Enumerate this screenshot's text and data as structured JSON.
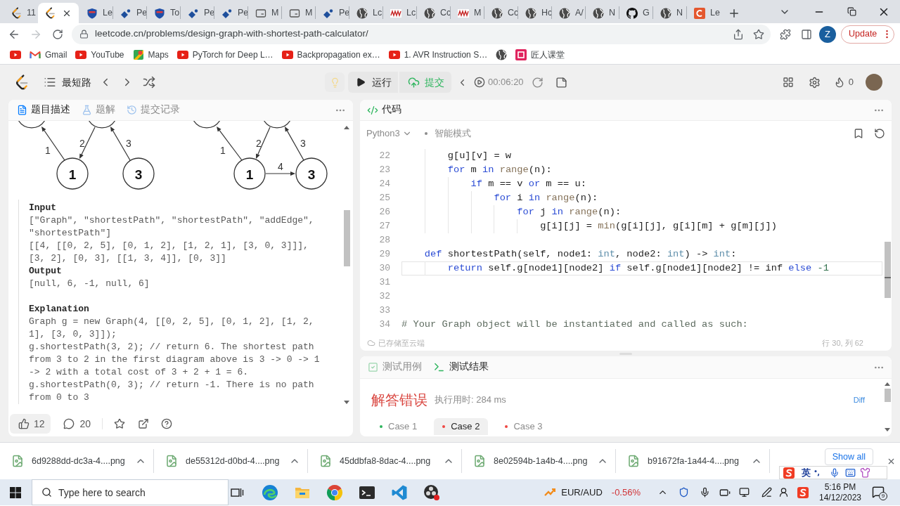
{
  "browser": {
    "tabs": [
      {
        "label": "11",
        "kind": "leetcode",
        "selected": false
      },
      {
        "kind": "leetcode",
        "selected": true
      },
      {
        "label": "Le",
        "kind": "shield",
        "selected": false
      },
      {
        "label": "Pe",
        "kind": "diamond",
        "selected": false
      },
      {
        "label": "To",
        "kind": "shield",
        "selected": false
      },
      {
        "label": "Pe",
        "kind": "diamond",
        "selected": false
      },
      {
        "label": "Pe",
        "kind": "diamond",
        "selected": false
      },
      {
        "label": "M",
        "kind": "card",
        "selected": false
      },
      {
        "label": "M",
        "kind": "card",
        "selected": false
      },
      {
        "label": "Pe",
        "kind": "diamond",
        "selected": false
      },
      {
        "label": "Lc",
        "kind": "globe",
        "selected": false
      },
      {
        "label": "Lc",
        "kind": "wave",
        "selected": false
      },
      {
        "label": "Cc",
        "kind": "globe",
        "selected": false
      },
      {
        "label": "M",
        "kind": "wave",
        "selected": false
      },
      {
        "label": "Cc",
        "kind": "globe",
        "selected": false
      },
      {
        "label": "Hc",
        "kind": "globe",
        "selected": false
      },
      {
        "label": "A/",
        "kind": "globe",
        "selected": false
      },
      {
        "label": "N",
        "kind": "globe",
        "selected": false
      },
      {
        "label": "G",
        "kind": "github",
        "selected": false
      },
      {
        "label": "N",
        "kind": "globe",
        "selected": false
      },
      {
        "label": "Le",
        "kind": "tile",
        "selected": false
      }
    ],
    "address": "leetcode.cn/problems/design-graph-with-shortest-path-calculator/",
    "profile": "Z",
    "update": "Update",
    "bookmarks": [
      {
        "kind": "youtube"
      },
      {
        "kind": "gmail",
        "label": "Gmail"
      },
      {
        "kind": "youtube",
        "label": "YouTube"
      },
      {
        "kind": "maps",
        "label": "Maps"
      },
      {
        "kind": "youtube",
        "label": "PyTorch for Deep L…"
      },
      {
        "kind": "youtube",
        "label": "Backpropagation ex…"
      },
      {
        "kind": "youtube",
        "label": "1. AVR Instruction S…"
      },
      {
        "kind": "globe"
      },
      {
        "kind": "badge",
        "label": "匠人课堂"
      }
    ]
  },
  "toolbar": {
    "problem_list": "最短路",
    "run": "运行",
    "submit": "提交",
    "timer": "00:06:20",
    "streak": "0"
  },
  "description": {
    "tabs": [
      {
        "label": "题目描述",
        "kind": "description",
        "selected": true
      },
      {
        "label": "题解",
        "kind": "solutions",
        "selected": false
      },
      {
        "label": "提交记录",
        "kind": "submissions",
        "selected": false
      }
    ],
    "diagrams": [
      {
        "kind": "before",
        "nodes": [
          "1",
          "3"
        ],
        "edge_labels": [
          "1",
          "2",
          "3"
        ]
      },
      {
        "kind": "after",
        "nodes": [
          "1",
          "3"
        ],
        "edge_labels": [
          "1",
          "2",
          "3",
          "4"
        ]
      }
    ],
    "example": {
      "io": [
        {
          "heading": "Input",
          "lines": [
            "[\"Graph\", \"shortestPath\", \"shortestPath\", \"addEdge\", \"shortestPath\"]",
            "[[4, [[0, 2, 5], [0, 1, 2], [1, 2, 1], [3, 0, 3]]], [3, 2], [0, 3], [[1, 3, 4]], [0, 3]]"
          ]
        },
        {
          "heading": "Output",
          "lines": [
            "[null, 6, -1, null, 6]"
          ]
        }
      ],
      "explanation": {
        "heading": "Explanation",
        "lines": [
          "Graph g = new Graph(4, [[0, 2, 5], [0, 1, 2], [1, 2, 1], [3, 0, 3]]);",
          "g.shortestPath(3, 2); // return 6. The shortest path from 3 to 2 in the first diagram above is 3 -> 0 -> 1 -> 2 with a total cost of 3 + 2 + 1 = 6.",
          "g.shortestPath(0, 3); // return -1. There is no path from 0 to 3"
        ]
      }
    },
    "likes": "12",
    "comments": "20"
  },
  "editor": {
    "title": "代码",
    "language": "Python3",
    "mode": "智能模式",
    "lines": [
      {
        "number": "22",
        "selected": false,
        "tokens": [
          {
            "kind": "plain",
            "text": "        g[u][v] = w"
          }
        ]
      },
      {
        "number": "23",
        "selected": false,
        "tokens": [
          {
            "kind": "keyword",
            "text": "        for"
          },
          {
            "kind": "plain",
            "text": " m "
          },
          {
            "kind": "keyword",
            "text": "in"
          },
          {
            "kind": "builtin",
            "text": " range"
          },
          {
            "kind": "plain",
            "text": "(n):"
          }
        ]
      },
      {
        "number": "24",
        "selected": false,
        "tokens": [
          {
            "kind": "keyword",
            "text": "            if"
          },
          {
            "kind": "plain",
            "text": " m == v "
          },
          {
            "kind": "keyword",
            "text": "or"
          },
          {
            "kind": "plain",
            "text": " m == u:"
          }
        ]
      },
      {
        "number": "25",
        "selected": false,
        "tokens": [
          {
            "kind": "keyword",
            "text": "                for"
          },
          {
            "kind": "plain",
            "text": " i "
          },
          {
            "kind": "keyword",
            "text": "in"
          },
          {
            "kind": "builtin",
            "text": " range"
          },
          {
            "kind": "plain",
            "text": "(n):"
          }
        ]
      },
      {
        "number": "26",
        "selected": false,
        "tokens": [
          {
            "kind": "keyword",
            "text": "                    for"
          },
          {
            "kind": "plain",
            "text": " j "
          },
          {
            "kind": "keyword",
            "text": "in"
          },
          {
            "kind": "builtin",
            "text": " range"
          },
          {
            "kind": "plain",
            "text": "(n):"
          }
        ]
      },
      {
        "number": "27",
        "selected": false,
        "tokens": [
          {
            "kind": "plain",
            "text": "                        g[i][j] = "
          },
          {
            "kind": "builtin",
            "text": "min"
          },
          {
            "kind": "plain",
            "text": "(g[i][j], g[i][m] + g[m][j])"
          }
        ]
      },
      {
        "number": "28",
        "selected": false
      },
      {
        "number": "29",
        "selected": false,
        "tokens": [
          {
            "kind": "keyword",
            "text": "    def"
          },
          {
            "kind": "plain",
            "text": " shortestPath(self, node1: "
          },
          {
            "kind": "type",
            "text": "int"
          },
          {
            "kind": "plain",
            "text": ", node2: "
          },
          {
            "kind": "type",
            "text": "int"
          },
          {
            "kind": "plain",
            "text": ") -> "
          },
          {
            "kind": "type",
            "text": "int"
          },
          {
            "kind": "plain",
            "text": ":"
          }
        ]
      },
      {
        "number": "30",
        "selected": true,
        "tokens": [
          {
            "kind": "keyword",
            "text": "        return"
          },
          {
            "kind": "plain",
            "text": " self.g[node1][node2] "
          },
          {
            "kind": "keyword",
            "text": "if"
          },
          {
            "kind": "plain",
            "text": " self.g[node1][node2] != inf "
          },
          {
            "kind": "keyword",
            "text": "else"
          },
          {
            "kind": "number",
            "text": " -1"
          }
        ]
      },
      {
        "number": "31",
        "selected": false
      },
      {
        "number": "32",
        "selected": false
      },
      {
        "number": "33",
        "selected": false
      },
      {
        "number": "34",
        "selected": false,
        "tokens": [
          {
            "kind": "comment",
            "text": "# Your Graph object will be instantiated and called as such:"
          }
        ]
      }
    ],
    "save_status": "已存储至云端",
    "position": "行 30, 列 62"
  },
  "tests": {
    "tabs": [
      {
        "label": "测试用例",
        "kind": "cases",
        "selected": false
      },
      {
        "label": "测试结果",
        "kind": "result",
        "selected": true
      }
    ],
    "verdict": "解答错误",
    "runtime": "执行用时: 284 ms",
    "diff": "Diff",
    "cases": [
      {
        "label": "Case 1",
        "selected": false,
        "color": "#2db55d"
      },
      {
        "label": "Case 2",
        "selected": true,
        "color": "#ef4743"
      },
      {
        "label": "Case 3",
        "selected": false,
        "color": "#ef4743"
      }
    ]
  },
  "downloads": {
    "files": [
      "6d9288dd-dc3a-4....png",
      "de55312d-d0bd-4....png",
      "45ddbfa8-8dac-4....png",
      "8e02594b-1a4b-4....png",
      "b91672fa-1a44-4....png"
    ],
    "show_all": "Show all"
  },
  "ime": {
    "mode": "英"
  },
  "taskbar": {
    "search": {
      "placeholder": "Type here to search"
    },
    "apps": [
      {
        "kind": "task_view"
      },
      {
        "kind": "edge"
      },
      {
        "kind": "explorer"
      },
      {
        "kind": "chrome"
      },
      {
        "kind": "terminal"
      },
      {
        "kind": "vscode"
      },
      {
        "kind": "recorder"
      }
    ],
    "ticker": {
      "pair": "EUR/AUD",
      "change": "-0.56%"
    },
    "time": "5:16 PM",
    "date": "14/12/2023",
    "notifications": "9"
  }
}
